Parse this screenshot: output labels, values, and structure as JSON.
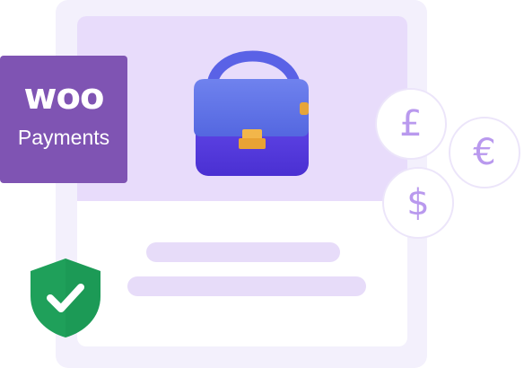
{
  "logo": {
    "brand": "woo",
    "product": "Payments",
    "color": "#7f54b3"
  },
  "coins": [
    {
      "symbol": "£",
      "icon": "pound-icon"
    },
    {
      "symbol": "€",
      "icon": "euro-icon"
    },
    {
      "symbol": "$",
      "icon": "dollar-icon"
    }
  ],
  "colors": {
    "accent": "#7f54b3",
    "shield": "#1fa05a",
    "coin_symbol": "#b999ee",
    "card_bg": "#f3f0fc",
    "product_bg": "#e8dcfb"
  },
  "icons": [
    "handbag-icon",
    "shield-check-icon"
  ]
}
